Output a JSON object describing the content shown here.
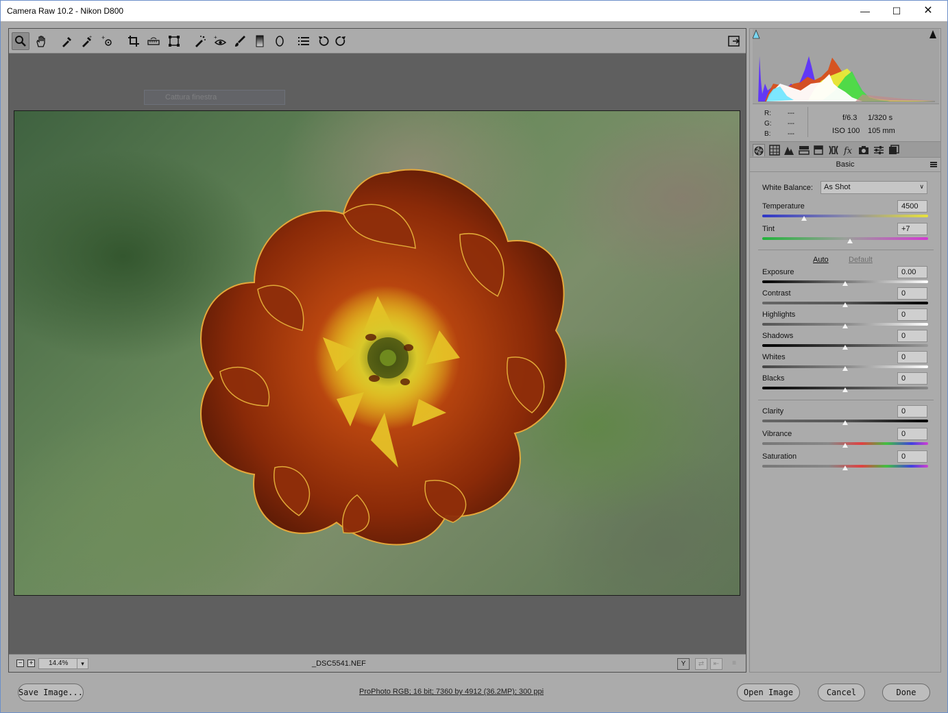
{
  "window": {
    "title": "Camera Raw 10.2  -  Nikon D800",
    "min": "—",
    "max": "☐",
    "close": "✕"
  },
  "toolbar": {
    "tools": [
      "zoom-icon",
      "hand-icon",
      "white-balance-icon",
      "color-sampler-icon",
      "targeted-adjustment-icon",
      "crop-icon",
      "straighten-icon",
      "transform-icon",
      "spot-removal-icon",
      "red-eye-icon",
      "adjustment-brush-icon",
      "graduated-filter-icon",
      "radial-filter-icon",
      "preferences-icon",
      "rotate-left-icon",
      "rotate-right-icon"
    ],
    "fullscreen_icon": "fullscreen-icon"
  },
  "ghost_tooltip": {
    "label": "Cattura finestra"
  },
  "statusbar": {
    "zoom_out": "−",
    "zoom_in": "+",
    "zoom_value": "14.4%",
    "zoom_arrow": "▾",
    "filename": "_DSC5541.NEF",
    "view_icons": [
      "Y",
      "⇄",
      "⇤",
      "≡"
    ]
  },
  "histogram": {
    "clip_shadow_icon": "shadow-clip-icon",
    "clip_highlight_icon": "highlight-clip-icon"
  },
  "readout": {
    "r_label": "R:",
    "g_label": "G:",
    "b_label": "B:",
    "r": "---",
    "g": "---",
    "b": "---",
    "aperture": "f/6.3",
    "shutter": "1/320 s",
    "iso": "ISO 100",
    "focal": "105 mm"
  },
  "panel_tabs": [
    "basic-icon",
    "tone-curve-icon",
    "detail-icon",
    "hsl-icon",
    "split-toning-icon",
    "lens-icon",
    "effects-icon",
    "calibration-icon",
    "presets-icon",
    "snapshots-icon"
  ],
  "basic": {
    "title": "Basic",
    "white_balance_label": "White Balance:",
    "white_balance_value": "As Shot",
    "temperature": {
      "label": "Temperature",
      "value": "4500",
      "fraction": 0.25
    },
    "tint": {
      "label": "Tint",
      "value": "+7",
      "fraction": 0.53
    },
    "auto": "Auto",
    "default": "Default",
    "tone": [
      {
        "label": "Exposure",
        "value": "0.00",
        "fraction": 0.5
      },
      {
        "label": "Contrast",
        "value": "0",
        "fraction": 0.5
      },
      {
        "label": "Highlights",
        "value": "0",
        "fraction": 0.5
      },
      {
        "label": "Shadows",
        "value": "0",
        "fraction": 0.5
      },
      {
        "label": "Whites",
        "value": "0",
        "fraction": 0.5
      },
      {
        "label": "Blacks",
        "value": "0",
        "fraction": 0.5
      }
    ],
    "presence": [
      {
        "label": "Clarity",
        "value": "0",
        "fraction": 0.5
      },
      {
        "label": "Vibrance",
        "value": "0",
        "fraction": 0.5
      },
      {
        "label": "Saturation",
        "value": "0",
        "fraction": 0.5
      }
    ]
  },
  "footer": {
    "save": "Save Image...",
    "info": "ProPhoto RGB; 16 bit; 7360 by 4912 (36.2MP); 300 ppi",
    "open": "Open Image",
    "cancel": "Cancel",
    "done": "Done"
  }
}
